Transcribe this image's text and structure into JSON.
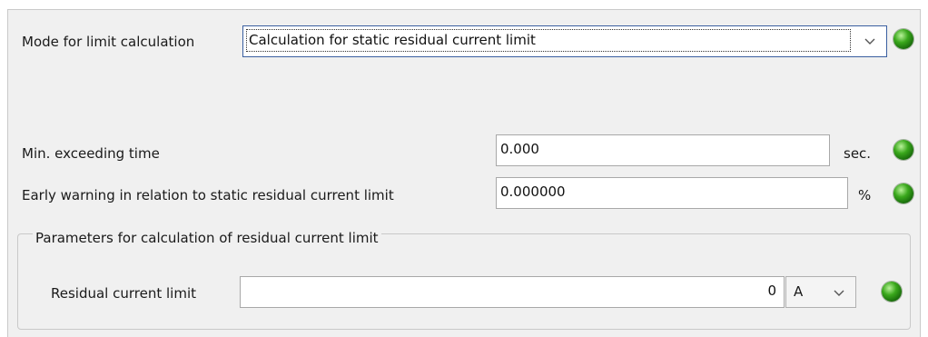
{
  "mode": {
    "label": "Mode for limit calculation",
    "selected": "Calculation for static residual current limit"
  },
  "min_exceeding_time": {
    "label": "Min. exceeding time",
    "value": "0.000",
    "unit": "sec."
  },
  "early_warning": {
    "label": "Early warning in relation to static residual current limit",
    "value": "0.000000",
    "unit": "%"
  },
  "params_group": {
    "title": "Parameters for calculation of residual current limit",
    "residual_current_limit": {
      "label": "Residual current limit",
      "value": "0",
      "unit": "A"
    }
  },
  "colors": {
    "status_led": "#2e9a18",
    "focus_border": "#3a5fa0",
    "panel_bg": "#f0f0f0"
  },
  "icons": [
    "chevron-down-icon",
    "status-led-icon"
  ]
}
